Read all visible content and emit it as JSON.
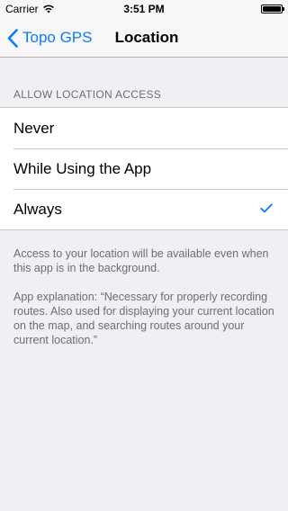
{
  "status_bar": {
    "carrier": "Carrier",
    "time": "3:51 PM",
    "wifi_icon": "wifi-icon",
    "battery_icon": "battery-icon",
    "battery_level": 1.0
  },
  "nav": {
    "back_label": "Topo GPS",
    "title": "Location",
    "back_icon": "chevron-left-icon"
  },
  "section": {
    "header": "ALLOW LOCATION ACCESS"
  },
  "options": [
    {
      "label": "Never",
      "selected": false
    },
    {
      "label": "While Using the App",
      "selected": false
    },
    {
      "label": "Always",
      "selected": true
    }
  ],
  "footer": {
    "background_note": "Access to your location will be available even when this app is in the background.",
    "explanation": "App explanation: “Necessary for properly recording routes. Also used for displaying your current location on the map, and searching routes around your current location.”"
  },
  "colors": {
    "accent": "#0a7aff",
    "background": "#efeff4",
    "secondary_text": "#6d6d72"
  }
}
